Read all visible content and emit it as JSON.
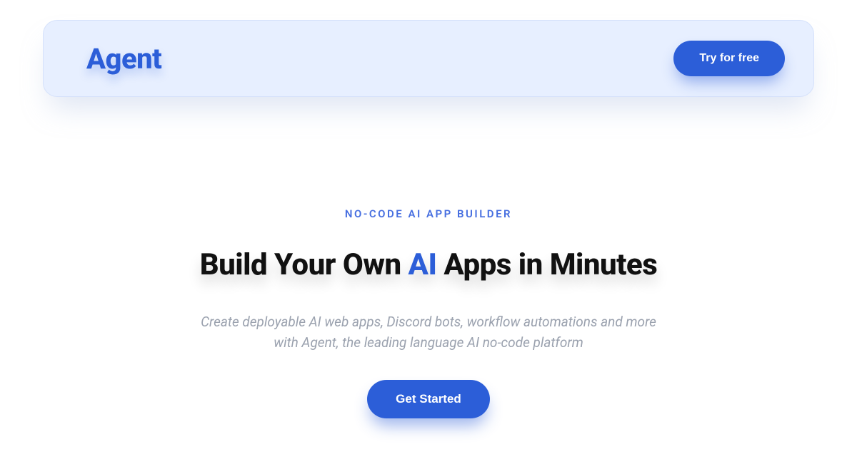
{
  "header": {
    "logo": "Agent",
    "cta_label": "Try for free"
  },
  "hero": {
    "eyebrow": "NO-CODE AI APP BUILDER",
    "headline_pre": "Build Your Own ",
    "headline_highlight": "AI",
    "headline_post": " Apps in Minutes",
    "subtitle_line1": "Create deployable AI web apps, Discord bots, workflow automations and more",
    "subtitle_line2": "with Agent, the leading language AI no-code platform",
    "cta_label": "Get Started"
  }
}
